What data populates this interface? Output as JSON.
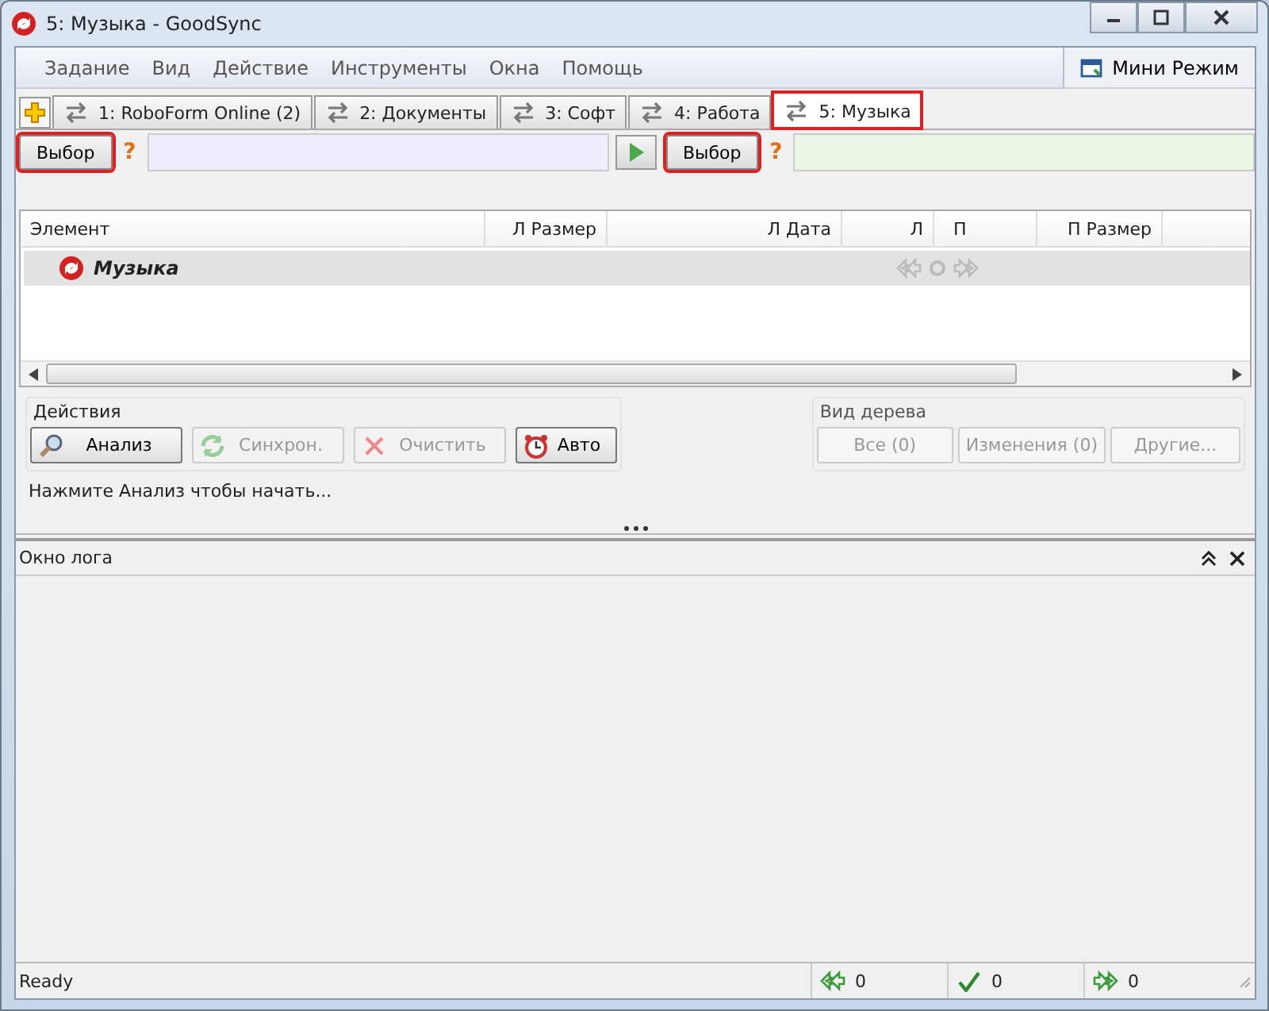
{
  "window": {
    "title": "5: Музыка - GoodSync"
  },
  "menu": [
    "Задание",
    "Вид",
    "Действие",
    "Инструменты",
    "Окна",
    "Помощь"
  ],
  "mini_mode": {
    "label": "Мини Режим"
  },
  "tabs": [
    {
      "label": "1: RoboForm Online (2)",
      "selected": false,
      "highlighted": false
    },
    {
      "label": "2: Документы",
      "selected": false,
      "highlighted": false
    },
    {
      "label": "3: Софт",
      "selected": false,
      "highlighted": false
    },
    {
      "label": "4: Работа",
      "selected": false,
      "highlighted": false
    },
    {
      "label": "5: Музыка",
      "selected": true,
      "highlighted": true
    }
  ],
  "left": {
    "button": "Выбор",
    "highlighted": true,
    "status": "?"
  },
  "right": {
    "button": "Выбор",
    "highlighted": true,
    "status": "?"
  },
  "table": {
    "columns": [
      "Элемент",
      "Л Размер",
      "Л Дата",
      "Л",
      "П",
      "П Размер"
    ],
    "rows": [
      {
        "name": "Музыка",
        "selected": true
      }
    ]
  },
  "actions": {
    "title": "Действия",
    "buttons": [
      {
        "label": "Анализ",
        "kind": "analyze",
        "disabled": false
      },
      {
        "label": "Синхрон.",
        "kind": "sync",
        "disabled": true
      },
      {
        "label": "Очистить",
        "kind": "clear",
        "disabled": true
      },
      {
        "label": "Авто",
        "kind": "auto",
        "disabled": false
      }
    ]
  },
  "tree_view": {
    "title": "Вид дерева",
    "buttons": [
      {
        "label": "Все (0)",
        "disabled": true
      },
      {
        "label": "Изменения (0)",
        "disabled": true
      },
      {
        "label": "Другие...",
        "disabled": true
      }
    ]
  },
  "hint": "Нажмите Анализ чтобы начать...",
  "log": {
    "title": "Окно лога"
  },
  "status_bar": {
    "text": "Ready",
    "counts": [
      {
        "kind": "left",
        "value": "0"
      },
      {
        "kind": "ok",
        "value": "0"
      },
      {
        "kind": "right",
        "value": "0"
      }
    ]
  }
}
